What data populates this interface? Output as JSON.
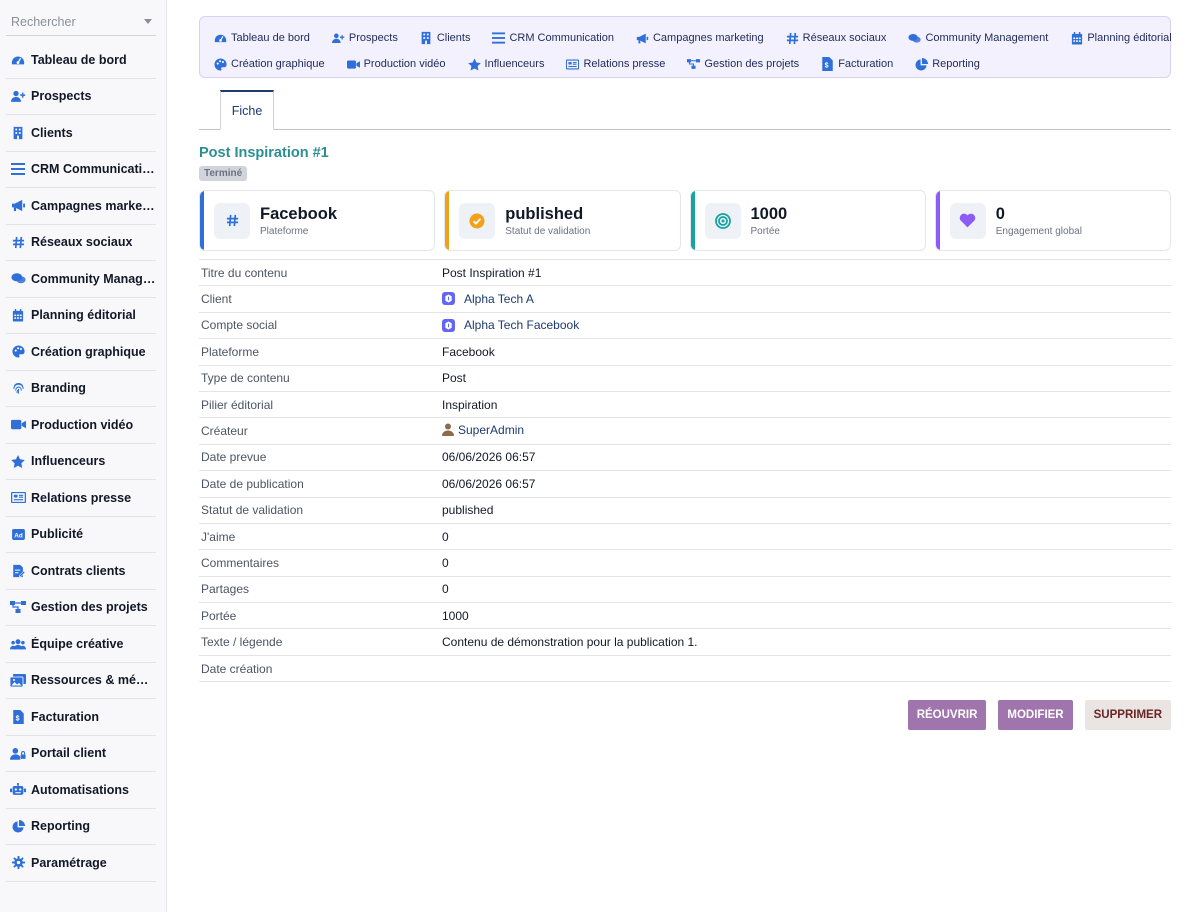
{
  "search": {
    "placeholder": "Rechercher"
  },
  "sidebar": {
    "items": [
      {
        "label": "Tableau de bord",
        "icon": "dashboard-icon"
      },
      {
        "label": "Prospects",
        "icon": "user-plus-icon"
      },
      {
        "label": "Clients",
        "icon": "building-icon"
      },
      {
        "label": "CRM Communication",
        "icon": "bars-icon"
      },
      {
        "label": "Campagnes marketing",
        "icon": "megaphone-icon"
      },
      {
        "label": "Réseaux sociaux",
        "icon": "hashtag-icon"
      },
      {
        "label": "Community Manage...",
        "icon": "comments-icon"
      },
      {
        "label": "Planning éditorial",
        "icon": "calendar-icon"
      },
      {
        "label": "Création graphique",
        "icon": "palette-icon"
      },
      {
        "label": "Branding",
        "icon": "fingerprint-icon"
      },
      {
        "label": "Production vidéo",
        "icon": "video-icon"
      },
      {
        "label": "Influenceurs",
        "icon": "star-icon"
      },
      {
        "label": "Relations presse",
        "icon": "newspaper-icon"
      },
      {
        "label": "Publicité",
        "icon": "ad-icon"
      },
      {
        "label": "Contrats clients",
        "icon": "contract-icon"
      },
      {
        "label": "Gestion des projets",
        "icon": "diagram-icon"
      },
      {
        "label": "Équipe créative",
        "icon": "team-icon"
      },
      {
        "label": "Ressources & médias",
        "icon": "images-icon"
      },
      {
        "label": "Facturation",
        "icon": "invoice-icon"
      },
      {
        "label": "Portail client",
        "icon": "user-lock-icon"
      },
      {
        "label": "Automatisations",
        "icon": "robot-icon"
      },
      {
        "label": "Reporting",
        "icon": "pie-chart-icon"
      },
      {
        "label": "Paramétrage",
        "icon": "gear-icon"
      }
    ]
  },
  "topnav": {
    "row1": [
      {
        "label": "Tableau de bord",
        "icon": "dashboard-icon"
      },
      {
        "label": "Prospects",
        "icon": "user-plus-icon"
      },
      {
        "label": "Clients",
        "icon": "building-icon"
      },
      {
        "label": "CRM Communication",
        "icon": "bars-icon"
      },
      {
        "label": "Campagnes marketing",
        "icon": "megaphone-icon"
      },
      {
        "label": "Réseaux sociaux",
        "icon": "hashtag-icon"
      },
      {
        "label": "Community Management",
        "icon": "comments-icon"
      },
      {
        "label": "Planning éditorial",
        "icon": "calendar-icon"
      }
    ],
    "row2": [
      {
        "label": "Création graphique",
        "icon": "palette-icon"
      },
      {
        "label": "Production vidéo",
        "icon": "video-icon"
      },
      {
        "label": "Influenceurs",
        "icon": "star-icon"
      },
      {
        "label": "Relations presse",
        "icon": "newspaper-icon"
      },
      {
        "label": "Gestion des projets",
        "icon": "diagram-icon"
      },
      {
        "label": "Facturation",
        "icon": "invoice-icon"
      },
      {
        "label": "Reporting",
        "icon": "pie-chart-icon"
      }
    ]
  },
  "tabs": {
    "fiche": "Fiche"
  },
  "record": {
    "title": "Post Inspiration #1",
    "status_badge": "Terminé"
  },
  "cards": [
    {
      "value": "Facebook",
      "label": "Plateforme",
      "accent": "#2f6fd8",
      "icon": "hashtag-icon"
    },
    {
      "value": "published",
      "label": "Statut de validation",
      "accent": "#f0a21b",
      "icon": "check-circle-icon"
    },
    {
      "value": "1000",
      "label": "Portée",
      "accent": "#16a3a3",
      "icon": "target-icon"
    },
    {
      "value": "0",
      "label": "Engagement global",
      "accent": "#8b5cf6",
      "icon": "heart-icon"
    }
  ],
  "fields": [
    {
      "key": "Titre du contenu",
      "value": "Post Inspiration #1"
    },
    {
      "key": "Client",
      "value": "Alpha Tech A",
      "link": true
    },
    {
      "key": "Compte social",
      "value": "Alpha Tech Facebook",
      "link": true
    },
    {
      "key": "Plateforme",
      "value": "Facebook"
    },
    {
      "key": "Type de contenu",
      "value": "Post"
    },
    {
      "key": "Pilier éditorial",
      "value": "Inspiration"
    },
    {
      "key": "Créateur",
      "value": "SuperAdmin",
      "user": true
    },
    {
      "key": "Date prevue",
      "value": "06/06/2026 06:57"
    },
    {
      "key": "Date de publication",
      "value": "06/06/2026 06:57"
    },
    {
      "key": "Statut de validation",
      "value": "published"
    },
    {
      "key": "J'aime",
      "value": "0"
    },
    {
      "key": "Commentaires",
      "value": "0"
    },
    {
      "key": "Partages",
      "value": "0"
    },
    {
      "key": "Portée",
      "value": "1000"
    },
    {
      "key": "Texte / légende",
      "value": "Contenu de démonstration pour la publication 1."
    },
    {
      "key": "Date création",
      "value": ""
    }
  ],
  "actions": {
    "reopen": "RÉOUVRIR",
    "edit": "MODIFIER",
    "delete": "SUPPRIMER"
  },
  "colors": {
    "nav_icon": "#2f6fd8",
    "title": "#2a8e92",
    "button_purple": "#a074ad"
  }
}
